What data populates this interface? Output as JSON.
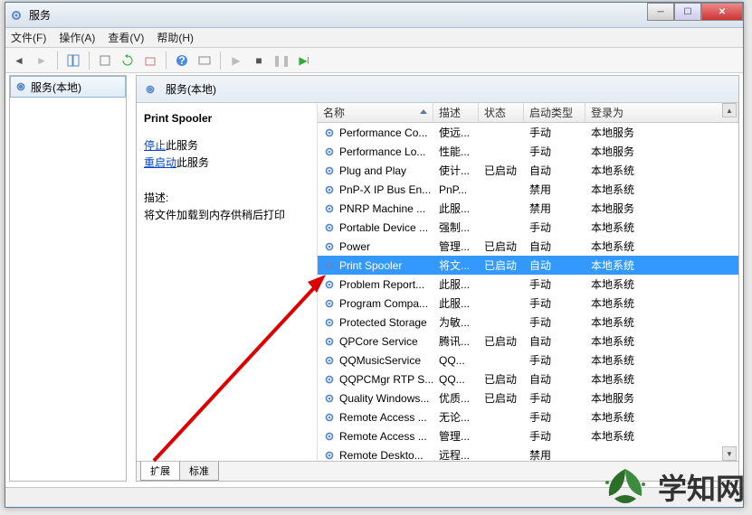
{
  "window": {
    "title": "服务"
  },
  "menu": {
    "file": "文件(F)",
    "action": "操作(A)",
    "view": "查看(V)",
    "help": "帮助(H)"
  },
  "tree": {
    "root": "服务(本地)"
  },
  "panel": {
    "header": "服务(本地)"
  },
  "detail": {
    "title": "Print Spooler",
    "stop": "停止",
    "stop_suffix": "此服务",
    "restart": "重启动",
    "restart_suffix": "此服务",
    "desc_label": "描述:",
    "desc_text": "将文件加载到内存供稍后打印"
  },
  "columns": {
    "name": "名称",
    "desc": "描述",
    "status": "状态",
    "startup": "启动类型",
    "logon": "登录为"
  },
  "tabs": {
    "extended": "扩展",
    "standard": "标准"
  },
  "watermark": "学知网",
  "services": [
    {
      "name": "Performance Co...",
      "desc": "使远...",
      "status": "",
      "startup": "手动",
      "logon": "本地服务"
    },
    {
      "name": "Performance Lo...",
      "desc": "性能...",
      "status": "",
      "startup": "手动",
      "logon": "本地服务"
    },
    {
      "name": "Plug and Play",
      "desc": "使计...",
      "status": "已启动",
      "startup": "自动",
      "logon": "本地系统"
    },
    {
      "name": "PnP-X IP Bus En...",
      "desc": "PnP...",
      "status": "",
      "startup": "禁用",
      "logon": "本地系统"
    },
    {
      "name": "PNRP Machine ...",
      "desc": "此服...",
      "status": "",
      "startup": "禁用",
      "logon": "本地服务"
    },
    {
      "name": "Portable Device ...",
      "desc": "强制...",
      "status": "",
      "startup": "手动",
      "logon": "本地系统"
    },
    {
      "name": "Power",
      "desc": "管理...",
      "status": "已启动",
      "startup": "自动",
      "logon": "本地系统"
    },
    {
      "name": "Print Spooler",
      "desc": "将文...",
      "status": "已启动",
      "startup": "自动",
      "logon": "本地系统",
      "selected": true
    },
    {
      "name": "Problem Report...",
      "desc": "此服...",
      "status": "",
      "startup": "手动",
      "logon": "本地系统"
    },
    {
      "name": "Program Compa...",
      "desc": "此服...",
      "status": "",
      "startup": "手动",
      "logon": "本地系统"
    },
    {
      "name": "Protected Storage",
      "desc": "为敏...",
      "status": "",
      "startup": "手动",
      "logon": "本地系统"
    },
    {
      "name": "QPCore Service",
      "desc": "腾讯...",
      "status": "已启动",
      "startup": "自动",
      "logon": "本地系统"
    },
    {
      "name": "QQMusicService",
      "desc": "QQ...",
      "status": "",
      "startup": "手动",
      "logon": "本地系统"
    },
    {
      "name": "QQPCMgr RTP S...",
      "desc": "QQ...",
      "status": "已启动",
      "startup": "自动",
      "logon": "本地系统"
    },
    {
      "name": "Quality Windows...",
      "desc": "优质...",
      "status": "已启动",
      "startup": "手动",
      "logon": "本地服务"
    },
    {
      "name": "Remote Access ...",
      "desc": "无论...",
      "status": "",
      "startup": "手动",
      "logon": "本地系统"
    },
    {
      "name": "Remote Access ...",
      "desc": "管理...",
      "status": "",
      "startup": "手动",
      "logon": "本地系统"
    },
    {
      "name": "Remote Deskto...",
      "desc": "远程...",
      "status": "",
      "startup": "禁用",
      "logon": ""
    }
  ]
}
